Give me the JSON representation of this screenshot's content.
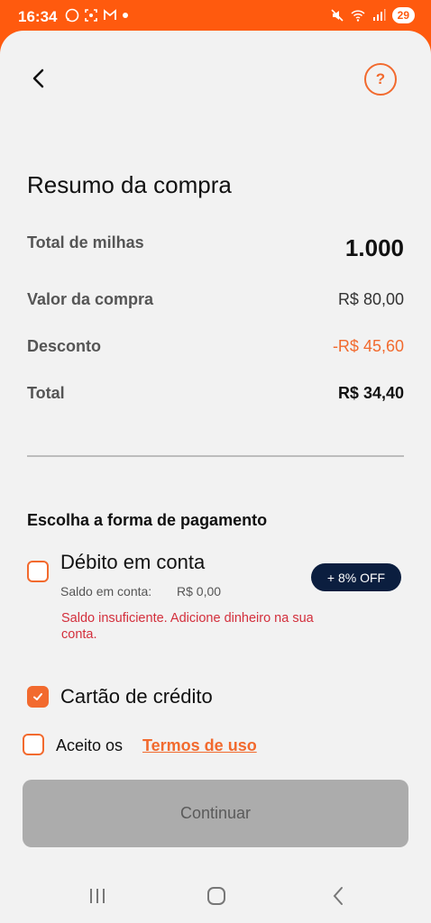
{
  "status_bar": {
    "time": "16:34",
    "left_icons": [
      "whatsapp-icon",
      "screenshot-icon",
      "gmail-icon",
      "dot-icon"
    ],
    "right_icons": [
      "mute-icon",
      "wifi-icon",
      "signal-icon"
    ],
    "battery": "29"
  },
  "header": {
    "back_icon": "chevron-left-icon",
    "help_label": "?"
  },
  "summary": {
    "title": "Resumo da compra",
    "rows": [
      {
        "label": "Total de milhas",
        "value": "1.000"
      },
      {
        "label": "Valor da compra",
        "value": "R$ 80,00"
      },
      {
        "label": "Desconto",
        "value": "-R$ 45,60"
      },
      {
        "label": "Total",
        "value": "R$ 34,40"
      }
    ]
  },
  "payment": {
    "section_title": "Escolha a forma de pagamento",
    "debit": {
      "title": "Débito em conta",
      "saldo_label": "Saldo em conta:",
      "saldo_value": "R$ 0,00",
      "error": "Saldo insuficiente. Adicione dinheiro na sua conta.",
      "badge": "+ 8% OFF",
      "checked": false
    },
    "credit": {
      "title": "Cartão de crédito",
      "checked": true
    }
  },
  "terms": {
    "prefix": "Aceito os",
    "link": "Termos de uso",
    "checked": false
  },
  "continue_label": "Continuar",
  "colors": {
    "accent": "#F26A2E",
    "status_bar": "#FF5A0E",
    "discount": "#F26A2E",
    "error": "#D32F3C",
    "badge_bg": "#0B1E3F",
    "button_disabled": "#ACACAC"
  },
  "nav_bar": {
    "icons": [
      "recent-apps-icon",
      "home-icon",
      "back-icon"
    ]
  }
}
